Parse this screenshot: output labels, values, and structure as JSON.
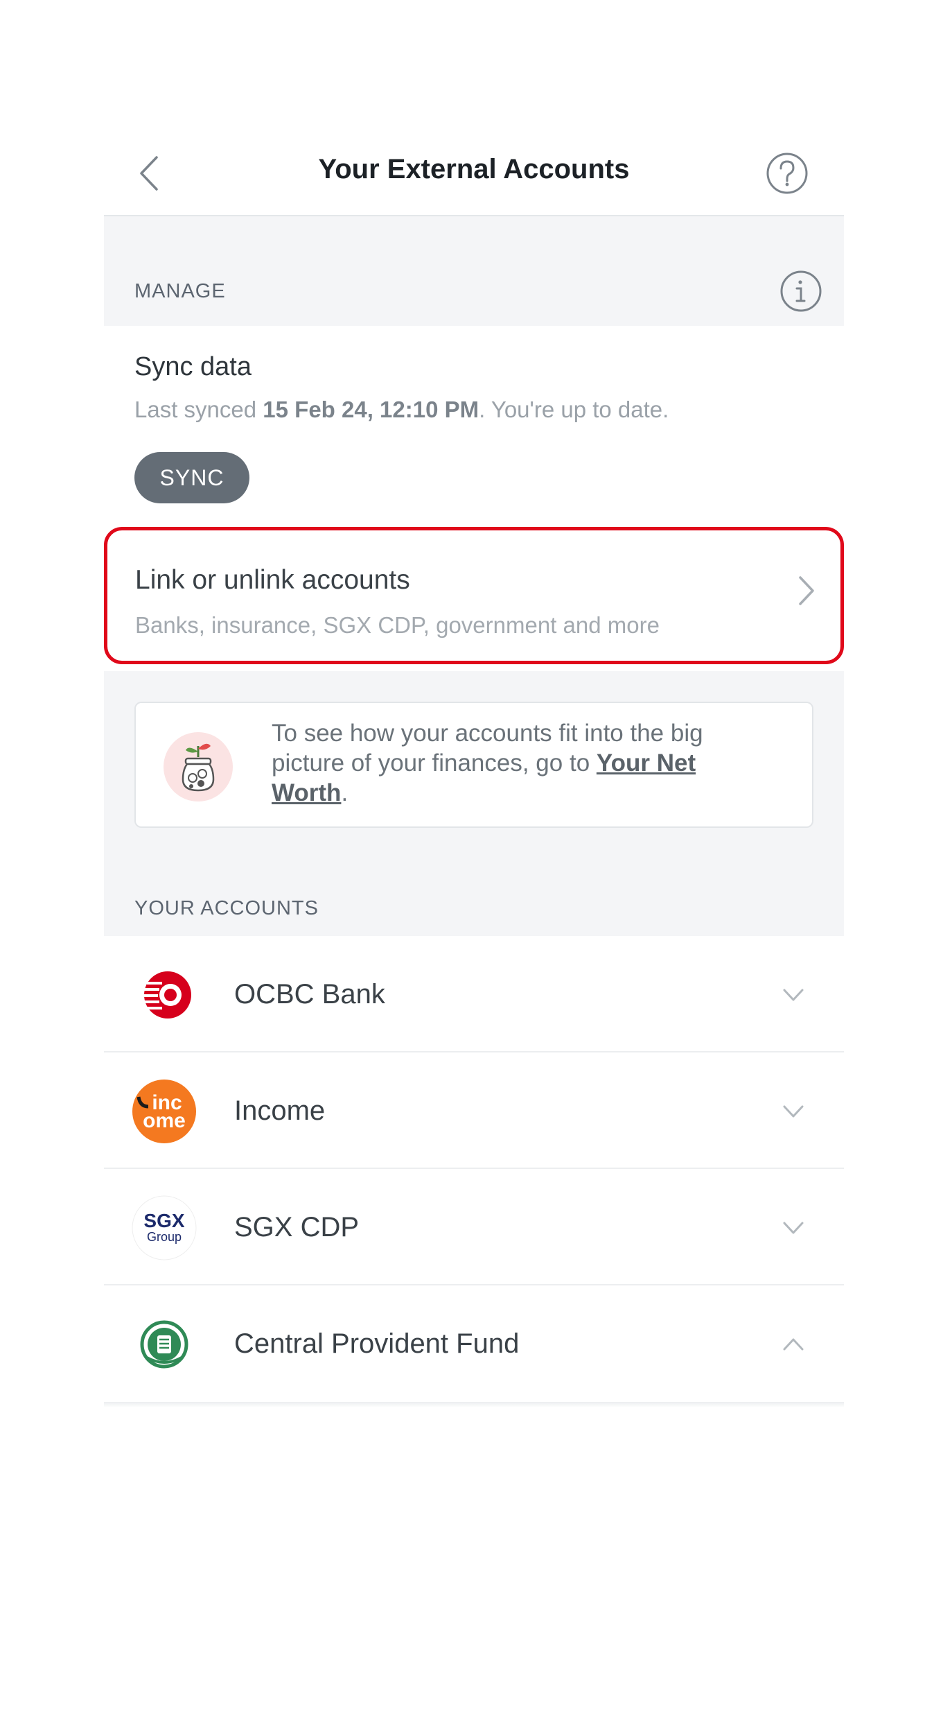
{
  "header": {
    "title": "Your External Accounts",
    "back_icon": "chevron-left-icon",
    "help_icon": "question-circle-icon"
  },
  "manage": {
    "section_label": "MANAGE",
    "info_icon": "info-circle-icon",
    "sync": {
      "title": "Sync data",
      "last_synced_prefix": "Last synced ",
      "last_synced_time": "15 Feb 24, 12:10 PM",
      "last_synced_suffix": ". You're up to date.",
      "button_label": "SYNC"
    },
    "link_accounts": {
      "title": "Link or unlink accounts",
      "subtitle": "Banks, insurance, SGX CDP, government and more",
      "highlight_color": "#e0091a"
    }
  },
  "net_worth_card": {
    "icon": "money-jar-plant-icon",
    "text_prefix": "To see how your accounts fit into the big picture of your finances, go to ",
    "link_text": "Your Net Worth",
    "text_suffix": "."
  },
  "accounts": {
    "section_label": "YOUR ACCOUNTS",
    "items": [
      {
        "name": "OCBC Bank",
        "logo": "ocbc-logo-icon",
        "expanded": false
      },
      {
        "name": "Income",
        "logo": "income-logo-icon",
        "logo_text_top": "inc",
        "logo_text_bottom": "ome",
        "expanded": false
      },
      {
        "name": "SGX CDP",
        "logo": "sgx-logo-icon",
        "logo_text_top": "SGX",
        "logo_text_bottom": "Group",
        "expanded": false
      },
      {
        "name": "Central Provident Fund",
        "logo": "cpf-logo-icon",
        "expanded": true
      }
    ]
  },
  "colors": {
    "sync_button": "#646d76",
    "section_background": "#f4f5f7",
    "ocbc_red": "#d6001c",
    "income_orange": "#f47920",
    "sgx_navy": "#1c2a6b",
    "cpf_green": "#2f8a56"
  }
}
